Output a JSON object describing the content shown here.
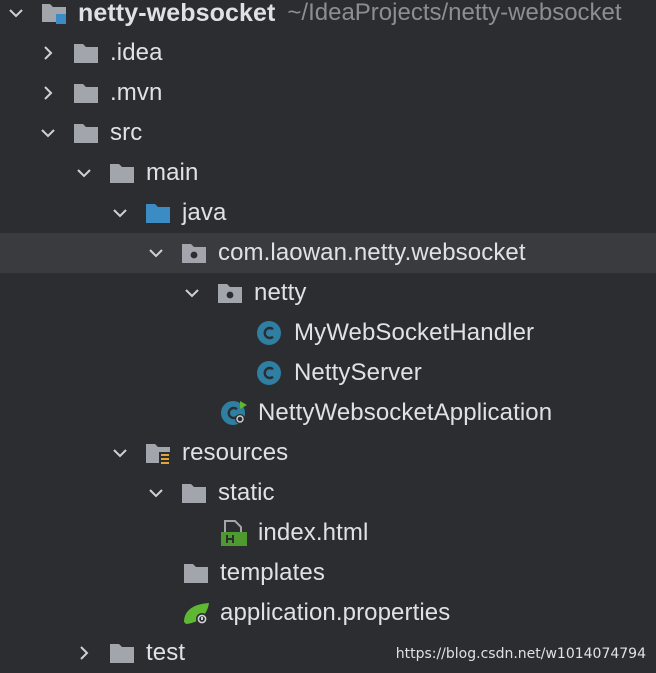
{
  "project": {
    "name": "netty-websocket",
    "path": "~/IdeaProjects/netty-websocket"
  },
  "tree": [
    {
      "label": ".idea",
      "depth": 1,
      "expanded": false,
      "icon": "folder-icon"
    },
    {
      "label": ".mvn",
      "depth": 1,
      "expanded": false,
      "icon": "folder-icon"
    },
    {
      "label": "src",
      "depth": 1,
      "expanded": true,
      "icon": "folder-icon"
    },
    {
      "label": "main",
      "depth": 2,
      "expanded": true,
      "icon": "folder-icon"
    },
    {
      "label": "java",
      "depth": 3,
      "expanded": true,
      "icon": "source-folder-icon"
    },
    {
      "label": "com.laowan.netty.websocket",
      "depth": 4,
      "expanded": true,
      "icon": "package-icon",
      "selected": true
    },
    {
      "label": "netty",
      "depth": 5,
      "expanded": true,
      "icon": "package-icon"
    },
    {
      "label": "MyWebSocketHandler",
      "depth": 6,
      "icon": "java-class-icon"
    },
    {
      "label": "NettyServer",
      "depth": 6,
      "icon": "java-class-icon"
    },
    {
      "label": "NettyWebsocketApplication",
      "depth": 5,
      "icon": "spring-boot-class-icon"
    },
    {
      "label": "resources",
      "depth": 3,
      "expanded": true,
      "icon": "resources-folder-icon"
    },
    {
      "label": "static",
      "depth": 4,
      "expanded": true,
      "icon": "folder-icon"
    },
    {
      "label": "index.html",
      "depth": 5,
      "icon": "html-file-icon"
    },
    {
      "label": "templates",
      "depth": 4,
      "icon": "folder-icon"
    },
    {
      "label": "application.properties",
      "depth": 4,
      "icon": "spring-properties-icon"
    },
    {
      "label": "test",
      "depth": 2,
      "expanded": false,
      "icon": "folder-icon"
    }
  ],
  "colors": {
    "background": "#2b2d30",
    "selected_row": "#3a3b3f",
    "folder": "#a2a5ab",
    "source_folder": "#3b8bc4",
    "class_badge": "#2f7fa3",
    "spring_green": "#5fb832",
    "html_green": "#4e9a2f"
  },
  "watermark": "https://blog.csdn.net/w1014074794"
}
